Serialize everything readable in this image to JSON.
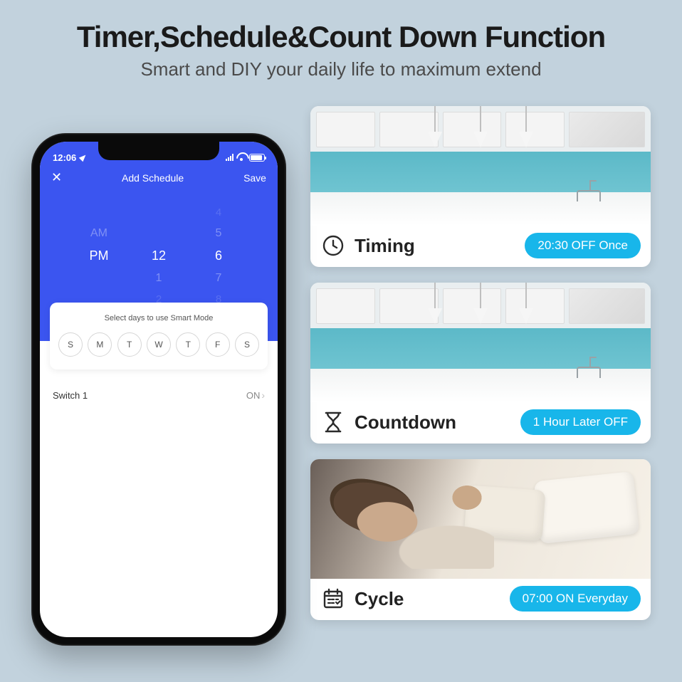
{
  "header": {
    "title": "Timer,Schedule&Count Down Function",
    "subtitle": "Smart and DIY your daily life to maximum extend"
  },
  "phone": {
    "status_time": "12:06",
    "nav_title": "Add Schedule",
    "nav_save": "Save",
    "picker": {
      "ampm_above": "AM",
      "ampm_sel": "PM",
      "hour_sel": "12",
      "hour_below": "1",
      "hour_below2": "2",
      "min_above2": "4",
      "min_above": "5",
      "min_sel": "6",
      "min_below": "7",
      "min_below2": "8"
    },
    "days_title": "Select days to use Smart Mode",
    "days": [
      "S",
      "M",
      "T",
      "W",
      "T",
      "F",
      "S"
    ],
    "switch_label": "Switch 1",
    "switch_state": "ON"
  },
  "cards": {
    "timing": {
      "label": "Timing",
      "pill": "20:30 OFF Once"
    },
    "countdown": {
      "label": "Countdown",
      "pill": "1 Hour Later OFF"
    },
    "cycle": {
      "label": "Cycle",
      "pill": "07:00 ON Everyday"
    }
  }
}
